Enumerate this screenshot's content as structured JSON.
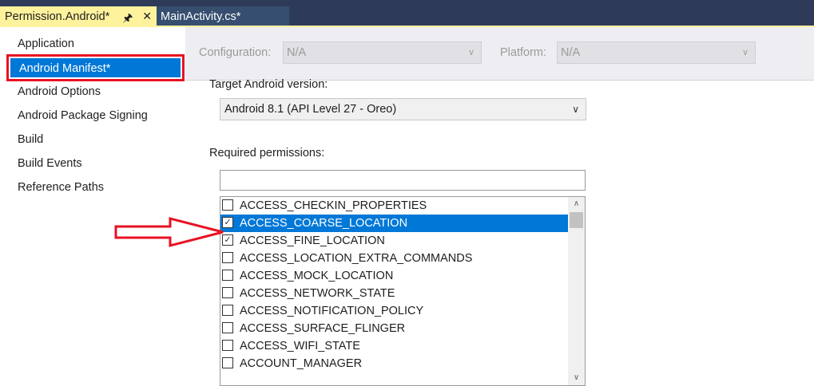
{
  "tabs": [
    {
      "label": "Permission.Android*",
      "active": true
    },
    {
      "label": "MainActivity.cs*",
      "active": false
    }
  ],
  "tab_icons": {
    "pin": "pin-icon",
    "close": "close-icon"
  },
  "sidebar": {
    "items": [
      {
        "label": "Application"
      },
      {
        "label": "Android Manifest*",
        "selected": true
      },
      {
        "label": "Android Options"
      },
      {
        "label": "Android Package Signing"
      },
      {
        "label": "Build"
      },
      {
        "label": "Build Events"
      },
      {
        "label": "Reference Paths"
      }
    ]
  },
  "config": {
    "configuration_label": "Configuration:",
    "configuration_value": "N/A",
    "platform_label": "Platform:",
    "platform_value": "N/A"
  },
  "manifest": {
    "target_label": "Target Android version:",
    "target_value": "Android 8.1 (API Level 27 - Oreo)",
    "permissions_label": "Required permissions:",
    "filter_value": "",
    "permissions": [
      {
        "name": "ACCESS_CHECKIN_PROPERTIES",
        "checked": false,
        "selected": false
      },
      {
        "name": "ACCESS_COARSE_LOCATION",
        "checked": true,
        "selected": true
      },
      {
        "name": "ACCESS_FINE_LOCATION",
        "checked": true,
        "selected": false
      },
      {
        "name": "ACCESS_LOCATION_EXTRA_COMMANDS",
        "checked": false,
        "selected": false
      },
      {
        "name": "ACCESS_MOCK_LOCATION",
        "checked": false,
        "selected": false
      },
      {
        "name": "ACCESS_NETWORK_STATE",
        "checked": false,
        "selected": false
      },
      {
        "name": "ACCESS_NOTIFICATION_POLICY",
        "checked": false,
        "selected": false
      },
      {
        "name": "ACCESS_SURFACE_FLINGER",
        "checked": false,
        "selected": false
      },
      {
        "name": "ACCESS_WIFI_STATE",
        "checked": false,
        "selected": false
      },
      {
        "name": "ACCOUNT_MANAGER",
        "checked": false,
        "selected": false
      }
    ]
  },
  "colors": {
    "selection": "#0078d7",
    "highlight_box": "#e81123",
    "annotation_arrow": "#e81123",
    "active_tab": "#fff29d"
  }
}
